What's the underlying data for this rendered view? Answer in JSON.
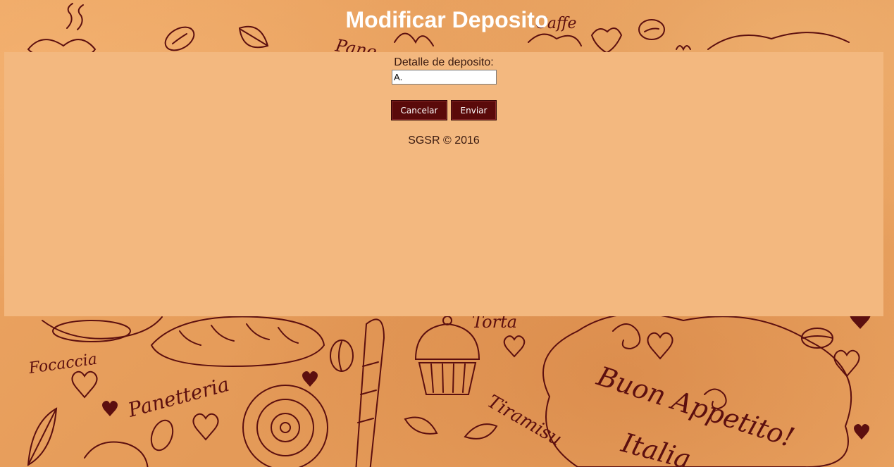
{
  "page": {
    "title": "Modificar Deposito"
  },
  "form": {
    "label": "Detalle de deposito:",
    "detail_value": "A.",
    "cancel_label": "Cancelar",
    "submit_label": "Enviar"
  },
  "footer": {
    "text": "SGSR © 2016"
  },
  "colors": {
    "background": "#e8a15f",
    "panel": "#f3b87f",
    "button": "#5a0a0a",
    "doodle": "#5c0f0f"
  },
  "background_text": {
    "focaccia": "Focaccia",
    "panetteria": "Panetteria",
    "tiramisu": "Tiramisu",
    "torta": "Torta",
    "buon_appetito": "Buon Appetito!",
    "italia": "Italia",
    "caffe": "Caffe",
    "pane": "Pane"
  }
}
